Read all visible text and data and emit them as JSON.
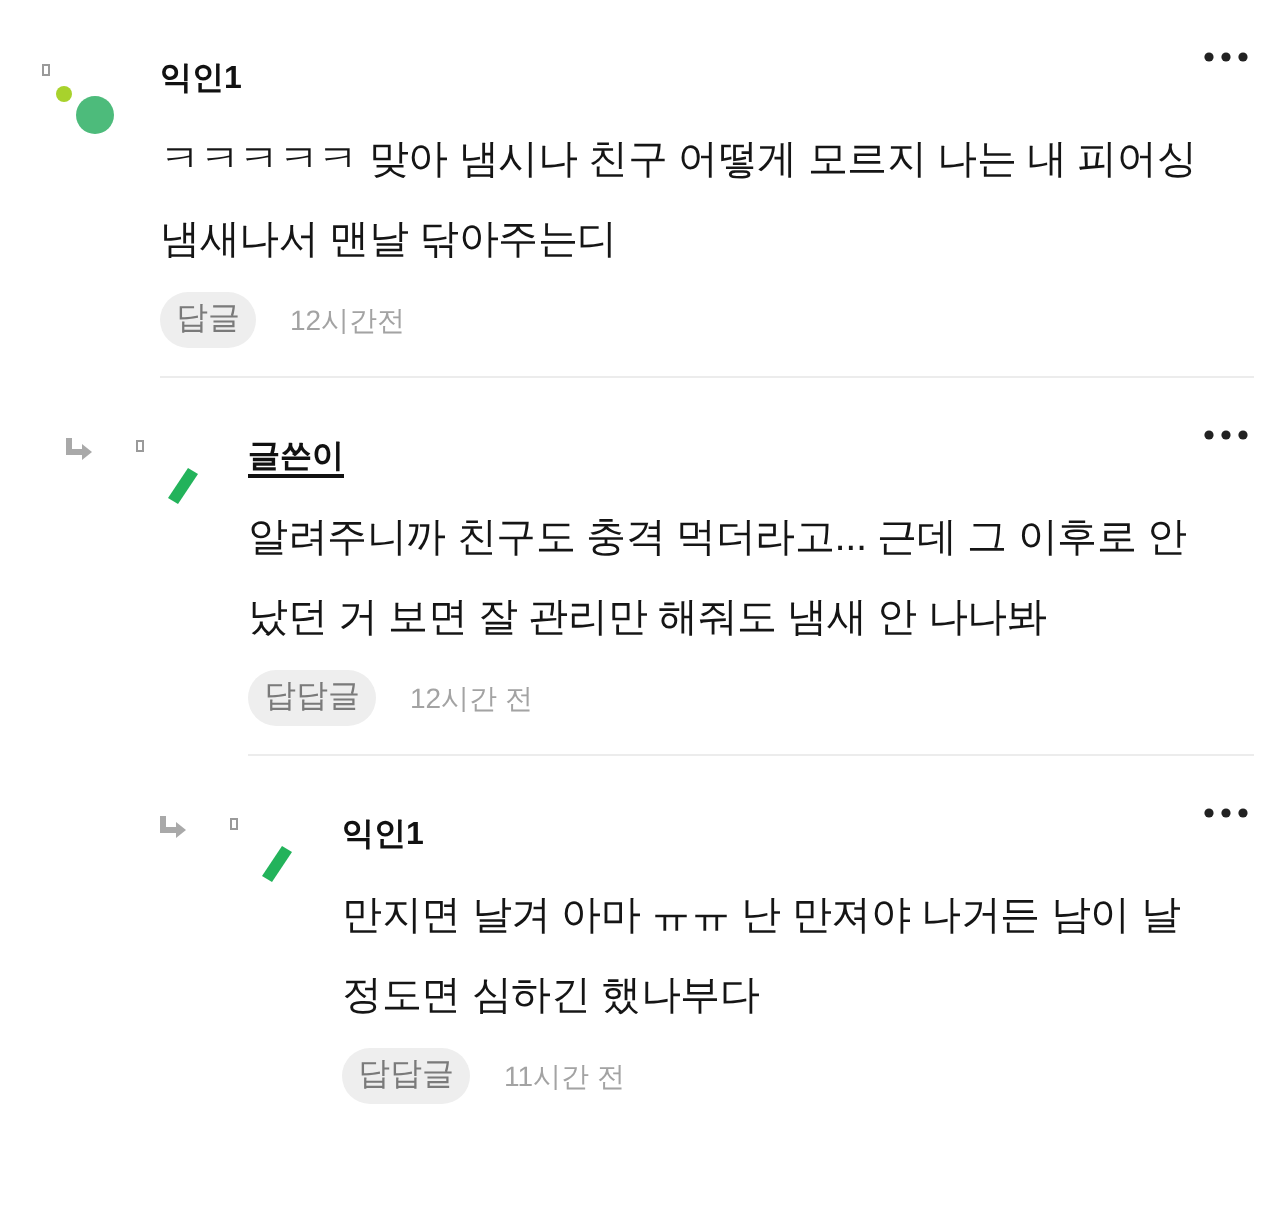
{
  "comments": [
    {
      "kind": "comment",
      "name": "익인1",
      "author": false,
      "text": "ㅋㅋㅋㅋㅋ 맞아 냄시나 친구 어떻게 모르지 나는 내 피어싱 냄새나서 맨날 닦아주는디",
      "reply_button": "답글",
      "time": "12시간전",
      "children": [
        {
          "kind": "reply",
          "name": "글쓴이",
          "author": true,
          "text": "알려주니까 친구도 충격 먹더라고... 근데 그 이후로 안 났던 거 보면 잘 관리만 해줘도 냄새 안 나나봐",
          "reply_button": "답답글",
          "time": "12시간 전",
          "children": [
            {
              "kind": "reply",
              "name": "익인1",
              "author": false,
              "text": "만지면 날겨 아마 ㅠㅠ 난 만져야 나거든 남이 날 정도면 심하긴 했나부다",
              "reply_button": "답답글",
              "time": "11시간 전"
            }
          ]
        }
      ]
    }
  ]
}
